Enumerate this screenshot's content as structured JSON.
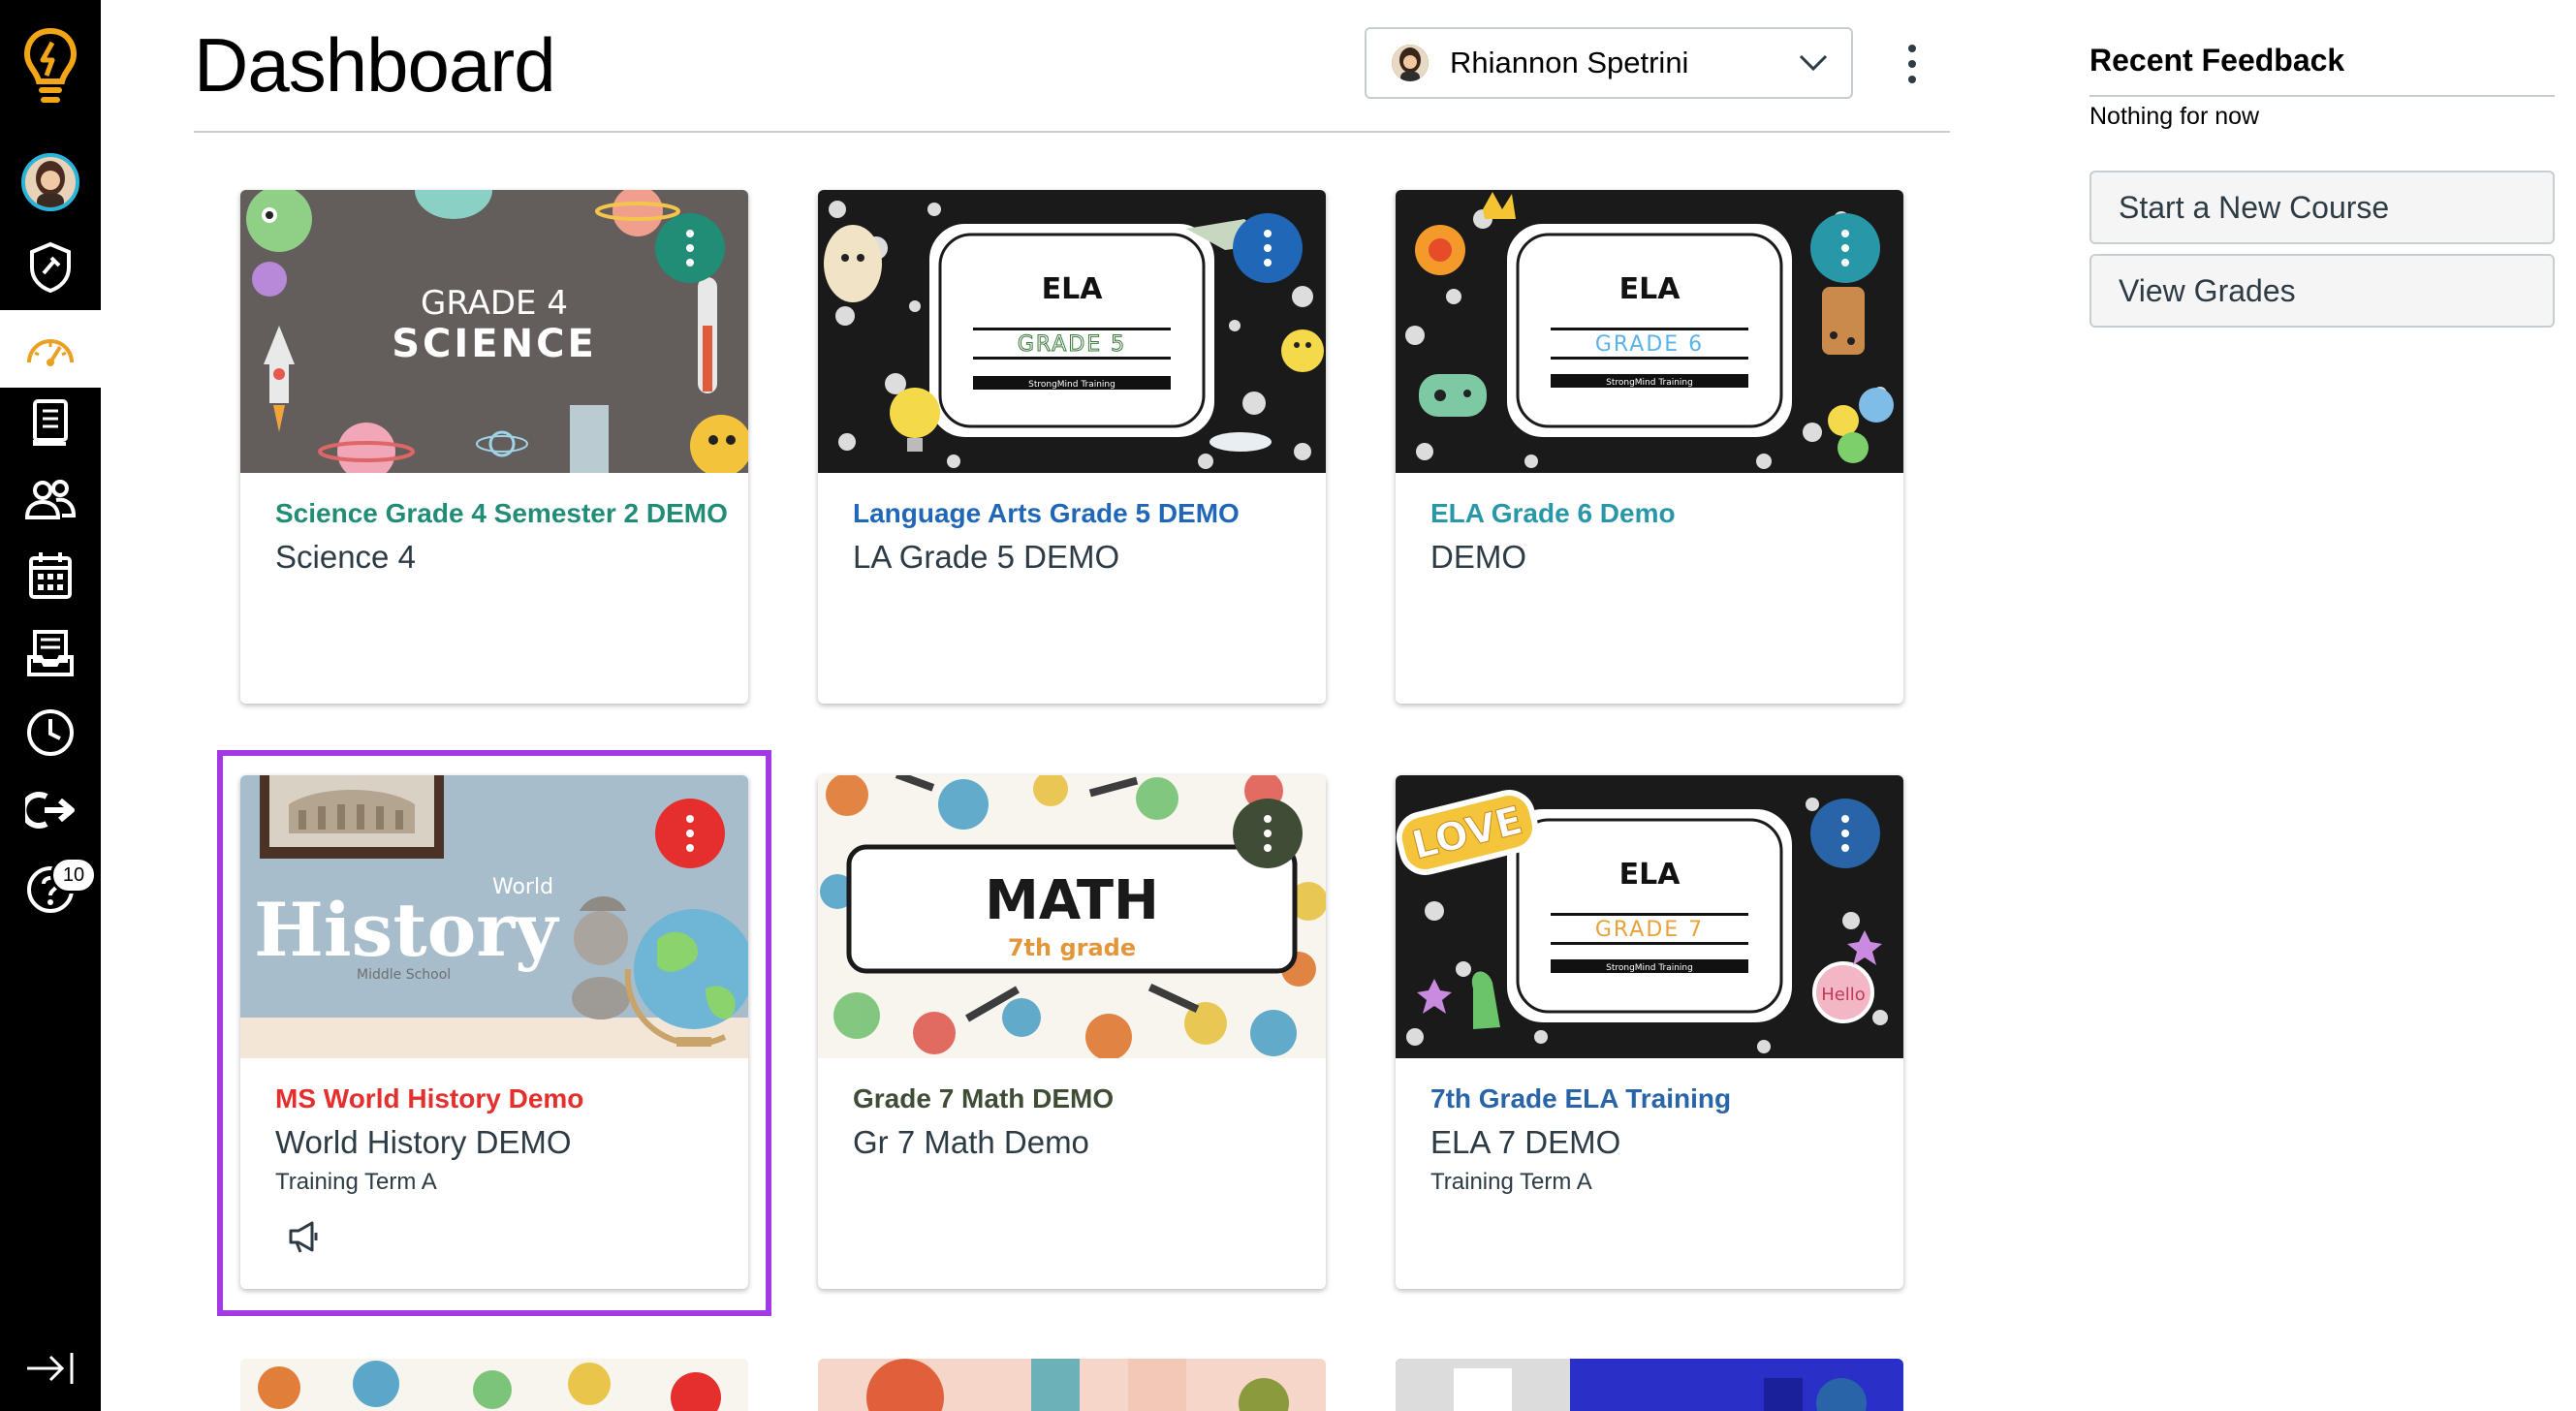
{
  "page": {
    "title": "Dashboard"
  },
  "global_nav": {
    "items": [
      {
        "name": "logo",
        "icon": "lightbulb-icon"
      },
      {
        "name": "account",
        "icon": "avatar-icon"
      },
      {
        "name": "admin",
        "icon": "shield-icon"
      },
      {
        "name": "dashboard",
        "icon": "speedometer-icon",
        "active": true
      },
      {
        "name": "courses",
        "icon": "book-icon"
      },
      {
        "name": "groups",
        "icon": "people-icon"
      },
      {
        "name": "calendar",
        "icon": "calendar-icon"
      },
      {
        "name": "inbox",
        "icon": "inbox-icon"
      },
      {
        "name": "history",
        "icon": "clock-icon"
      },
      {
        "name": "commons",
        "icon": "share-arrow-icon"
      },
      {
        "name": "help",
        "icon": "help-icon"
      }
    ],
    "help_badge": "10",
    "collapse_icon": "collapse-nav-icon"
  },
  "header": {
    "user_select": {
      "value": "Rhiannon Spetrini"
    }
  },
  "recent_feedback": {
    "heading": "Recent Feedback",
    "empty": "Nothing for now"
  },
  "sidebar_buttons": {
    "new_course": "Start a New Course",
    "view_grades": "View Grades"
  },
  "cards": [
    {
      "title": "Science Grade 4 Semester 2 DEMO",
      "code": "Science 4",
      "term": "",
      "color": "#218d76",
      "hero_text": [
        "GRADE 4",
        "SCIENCE"
      ]
    },
    {
      "title": "Language Arts Grade 5 DEMO",
      "code": "LA Grade 5 DEMO",
      "term": "",
      "color": "#2067b8",
      "hero_text": [
        "ELA",
        "GRADE 5",
        "StrongMind Training"
      ]
    },
    {
      "title": "ELA Grade 6 Demo",
      "code": "DEMO",
      "term": "",
      "color": "#2897a8",
      "hero_text": [
        "ELA",
        "GRADE 6",
        "StrongMind Training"
      ]
    },
    {
      "title": "MS World History Demo",
      "code": "World History DEMO",
      "term": "Training Term A",
      "color": "#e42f2d",
      "hero_text": [
        "World",
        "History",
        "Middle School"
      ]
    },
    {
      "title": "Grade 7 Math DEMO",
      "code": "Gr 7 Math Demo",
      "term": "",
      "color": "#3f4d37",
      "hero_text": [
        "MATH",
        "7th grade"
      ]
    },
    {
      "title": "7th Grade ELA Training",
      "code": "ELA 7 DEMO",
      "term": "Training Term A",
      "color": "#2a64a8",
      "hero_text": [
        "ELA",
        "GRADE 7",
        "StrongMind Training",
        "LOVE",
        "Hello"
      ]
    }
  ]
}
